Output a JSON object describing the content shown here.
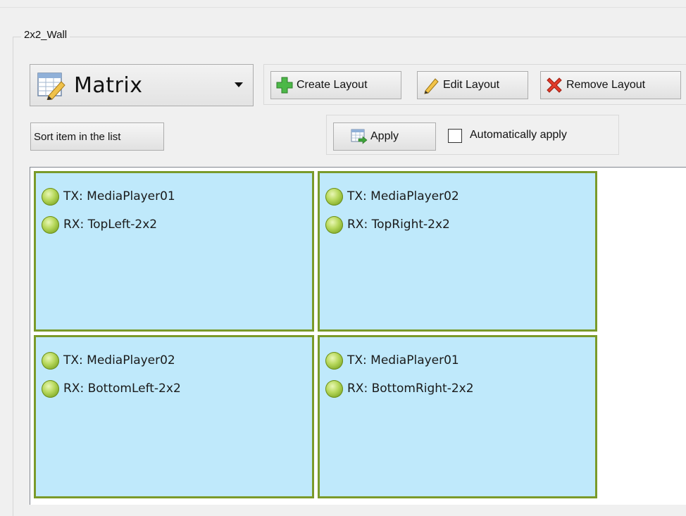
{
  "group": {
    "title": "2x2_Wall"
  },
  "layout_selector": {
    "selected": "Matrix",
    "icon": "matrix-table-icon"
  },
  "toolbar": {
    "create_label": "Create Layout",
    "edit_label": "Edit Layout",
    "remove_label": "Remove Layout"
  },
  "sort_label": "Sort item in the list",
  "apply": {
    "label": "Apply",
    "auto_label": "Automatically apply",
    "auto_checked": false
  },
  "wall": {
    "cells": [
      {
        "tx": "TX: MediaPlayer01",
        "rx": "RX: TopLeft-2x2"
      },
      {
        "tx": "TX: MediaPlayer02",
        "rx": "RX: TopRight-2x2"
      },
      {
        "tx": "TX: MediaPlayer02",
        "rx": "RX: BottomLeft-2x2"
      },
      {
        "tx": "TX: MediaPlayer01",
        "rx": "RX: BottomRight-2x2"
      }
    ]
  },
  "colors": {
    "cell_bg": "#bfe9fb",
    "cell_border": "#7a9a2a",
    "status_ok": "#9cc83d"
  }
}
